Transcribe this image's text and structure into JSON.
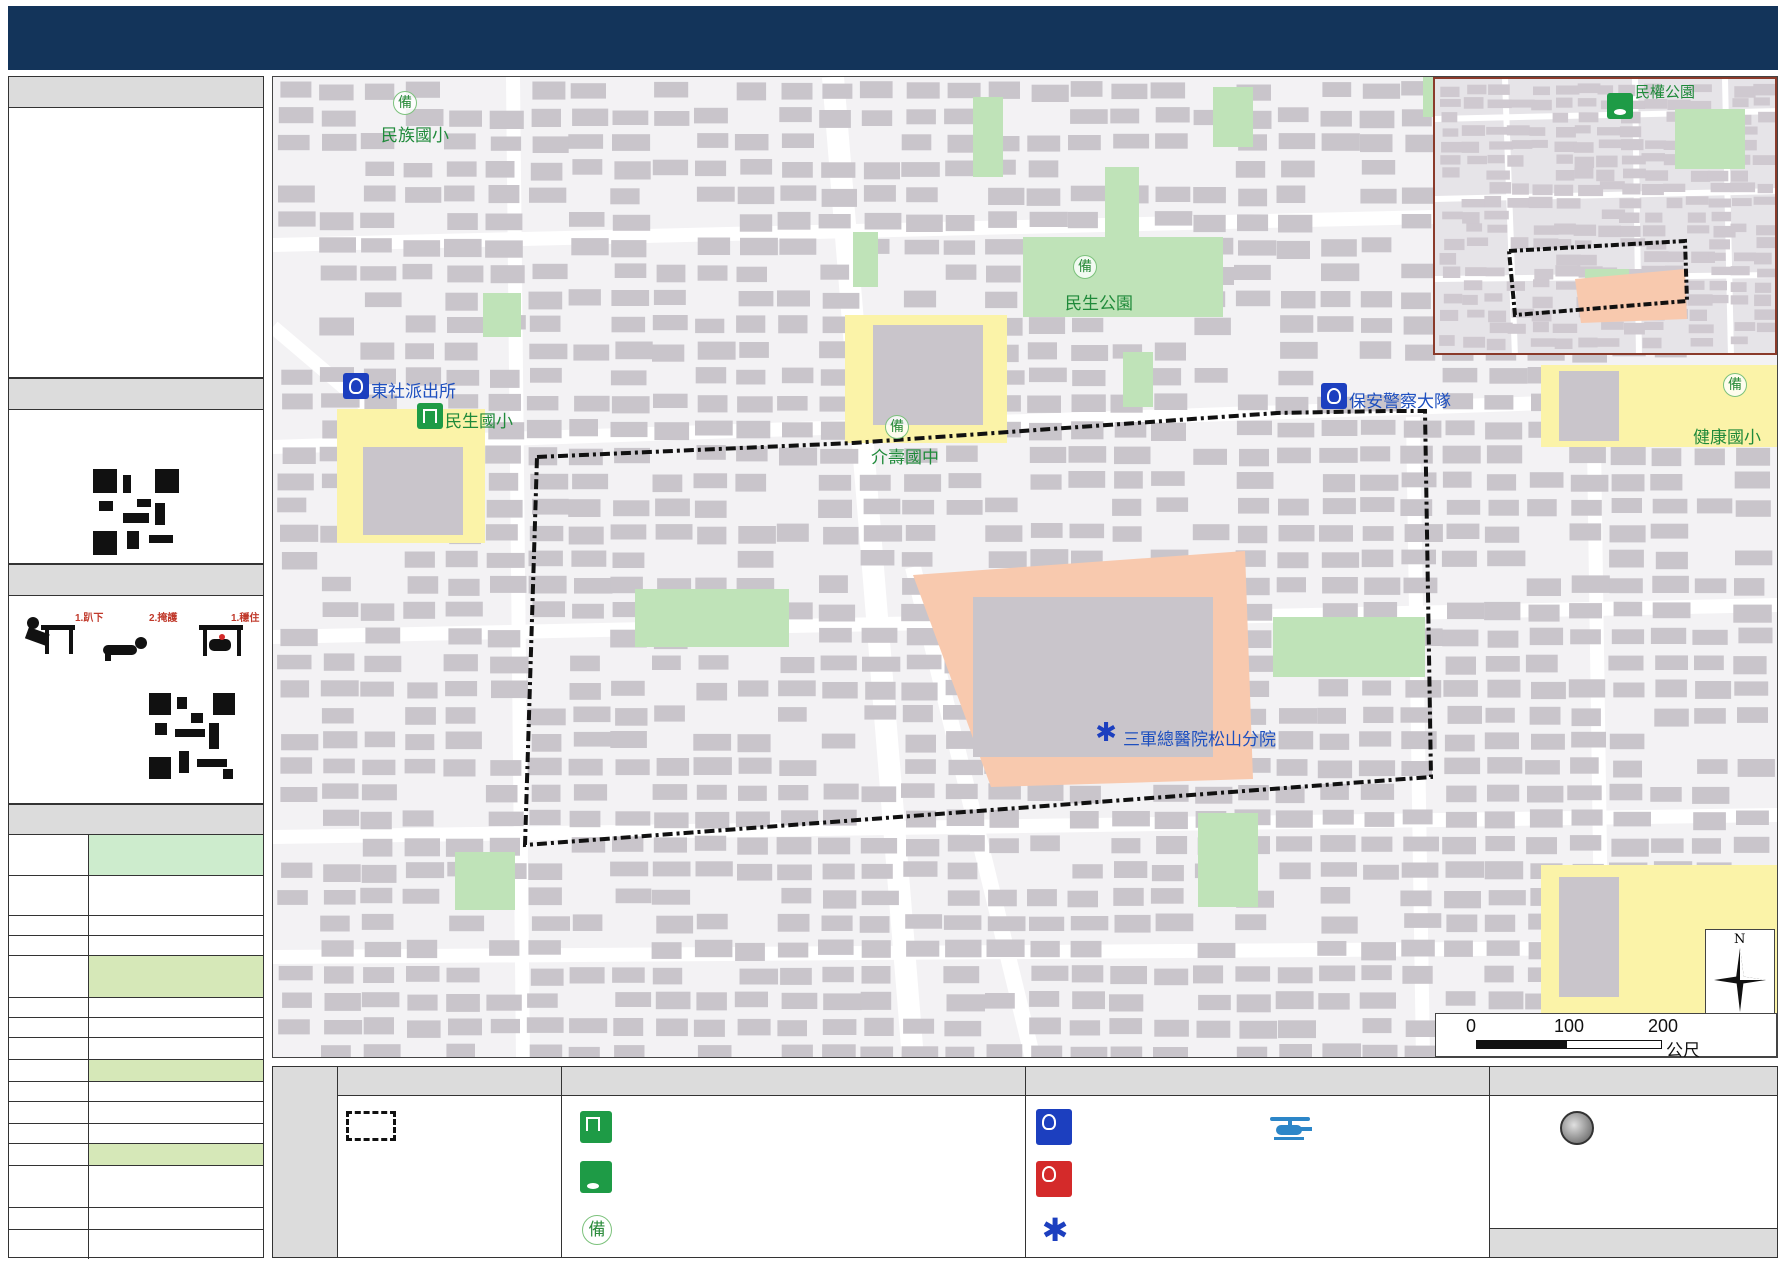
{
  "map": {
    "labels": {
      "minzu_school": "民族國小",
      "minsheng_park": "民生公園",
      "dongshe_police": "東社派出所",
      "minsheng_school": "民生國小",
      "jieshou_jhs": "介壽國中",
      "security_police": "保安警察大隊",
      "jiankang_school": "健康國小",
      "hospital": "三軍總醫院松山分院",
      "minquan_park": "民權公園"
    },
    "bei_glyph": "備",
    "scale": {
      "t0": "0",
      "t1": "100",
      "t2": "200",
      "unit": "公尺"
    },
    "compass": {
      "north": "N"
    }
  },
  "left_panel": {
    "drill_steps": {
      "step1": "1.趴下",
      "step2": "2.掩護",
      "step3": "1.穩住"
    }
  },
  "legend": {
    "bei_glyph": "備"
  },
  "colors": {
    "header": "#13345a",
    "park": "#bfe3b8",
    "school": "#fbf3a8",
    "hospital": "#f8c9ae",
    "building": "#c9c5cb",
    "evac_boundary": "#111111"
  },
  "icons": [
    "police-icon",
    "fire-station-icon",
    "shelter-icon",
    "evacuation-site-icon",
    "standby-shelter-icon",
    "medical-icon",
    "helicopter-icon",
    "gathering-point-icon"
  ]
}
